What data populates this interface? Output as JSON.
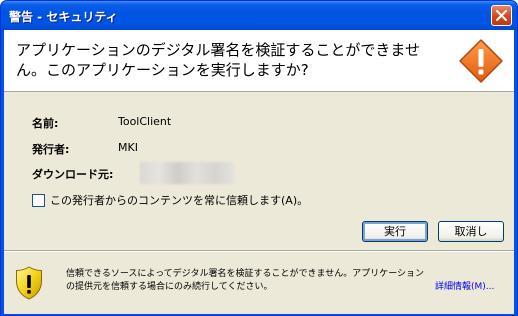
{
  "titlebar": {
    "title": "警告 - セキュリティ",
    "close_icon": "close-icon"
  },
  "header": {
    "message": "アプリケーションのデジタル署名を検証することができません。このアプリケーションを実行しますか?",
    "icon": "warning-diamond-icon"
  },
  "details": {
    "name_label": "名前:",
    "name_value": "ToolClient",
    "publisher_label": "発行者:",
    "publisher_value": "MKI",
    "download_label": "ダウンロード元:"
  },
  "checkbox": {
    "label": "この発行者からのコンテンツを常に信頼します(A)。",
    "checked": false
  },
  "buttons": {
    "run": "実行",
    "cancel": "取消し"
  },
  "footer": {
    "message": "信頼できるソースによってデジタル署名を検証することができません。アプリケーションの提供元を信頼する場合にのみ続行してください。",
    "more_info": "詳細情報(M)...",
    "icon": "shield-warning-icon"
  }
}
